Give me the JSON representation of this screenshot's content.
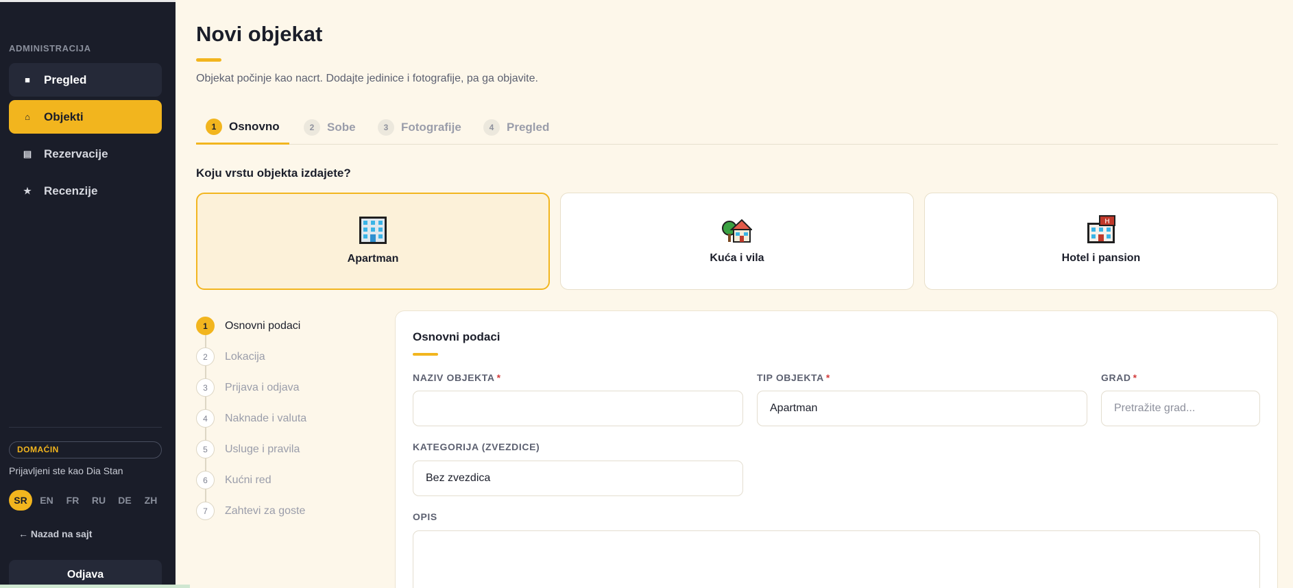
{
  "sidebar": {
    "section_label": "ADMINISTRACIJA",
    "items": [
      {
        "label": "Pregled",
        "icon": "dashboard-icon",
        "glyph": "■"
      },
      {
        "label": "Objekti",
        "icon": "home-icon",
        "glyph": "⌂"
      },
      {
        "label": "Rezervacije",
        "icon": "list-icon",
        "glyph": "▤"
      },
      {
        "label": "Recenzije",
        "icon": "star-icon",
        "glyph": "★"
      }
    ],
    "role_badge": "DOMAĆIN",
    "logged_in_as": "Prijavljeni ste kao Dia Stan",
    "languages": [
      "SR",
      "EN",
      "FR",
      "RU",
      "DE",
      "ZH"
    ],
    "active_language": "SR",
    "back_link": "← Nazad na sajt",
    "logout": "Odjava"
  },
  "header": {
    "title": "Novi objekat",
    "subtitle": "Objekat počinje kao nacrt. Dodajte jedinice i fotografije, pa ga objavite."
  },
  "tabs": [
    {
      "num": "1",
      "label": "Osnovno"
    },
    {
      "num": "2",
      "label": "Sobe"
    },
    {
      "num": "3",
      "label": "Fotografije"
    },
    {
      "num": "4",
      "label": "Pregled"
    }
  ],
  "property_types": {
    "question": "Koju vrstu objekta izdajete?",
    "options": [
      {
        "label": "Apartman",
        "icon": "apartment-building-icon"
      },
      {
        "label": "Kuća i vila",
        "icon": "house-with-garden-icon"
      },
      {
        "label": "Hotel i pansion",
        "icon": "hotel-icon"
      }
    ],
    "selected": "Apartman"
  },
  "steps": [
    {
      "num": "1",
      "label": "Osnovni podaci"
    },
    {
      "num": "2",
      "label": "Lokacija"
    },
    {
      "num": "3",
      "label": "Prijava i odjava"
    },
    {
      "num": "4",
      "label": "Naknade i valuta"
    },
    {
      "num": "5",
      "label": "Usluge i pravila"
    },
    {
      "num": "6",
      "label": "Kućni red"
    },
    {
      "num": "7",
      "label": "Zahtevi za goste"
    }
  ],
  "form": {
    "title": "Osnovni podaci",
    "name": {
      "label": "NAZIV OBJEKTA",
      "required": "*",
      "value": ""
    },
    "type": {
      "label": "TIP OBJEKTA",
      "required": "*",
      "value": "Apartman"
    },
    "city": {
      "label": "GRAD",
      "required": "*",
      "placeholder": "Pretražite grad..."
    },
    "category": {
      "label": "KATEGORIJA (ZVEZDICE)",
      "value": "Bez zvezdica"
    },
    "description": {
      "label": "OPIS",
      "value": ""
    }
  },
  "colors": {
    "accent": "#f2b51e",
    "sidebar_bg": "#1a1d29",
    "page_bg": "#fdf7ea"
  }
}
